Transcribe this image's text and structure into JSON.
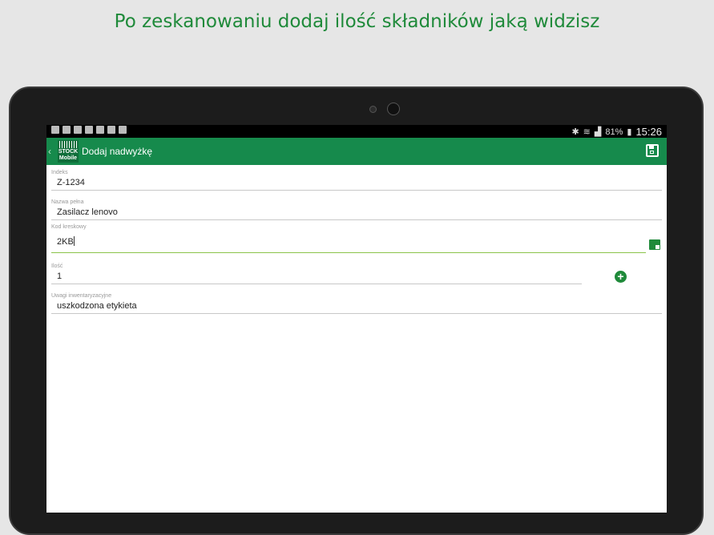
{
  "caption": "Po zeskanowaniu dodaj ilość składników jaką widzisz",
  "statusbar": {
    "battery": "81%",
    "time": "15:26"
  },
  "appbar": {
    "logo_line1": "STOCK",
    "logo_line2": "Mobile",
    "title": "Dodaj nadwyżkę"
  },
  "form": {
    "index": {
      "label": "Indeks",
      "value": "Z-1234"
    },
    "full_name": {
      "label": "Nazwa pełna",
      "value": "Zasilacz lenovo"
    },
    "barcode": {
      "label": "Kod kreskowy",
      "value": "2KB"
    },
    "quantity": {
      "label": "Ilość",
      "value": "1"
    },
    "notes": {
      "label": "Uwagi inwentaryzacyjne",
      "value": "uszkodzona etykieta"
    }
  },
  "icons": {
    "back": "chevron-left-icon",
    "save": "save-icon",
    "scan": "barcode-scan-icon",
    "add": "plus-circle-icon"
  },
  "colors": {
    "accent": "#168a4c",
    "caption": "#1f8a3a",
    "focus_line": "#8bc34a"
  }
}
